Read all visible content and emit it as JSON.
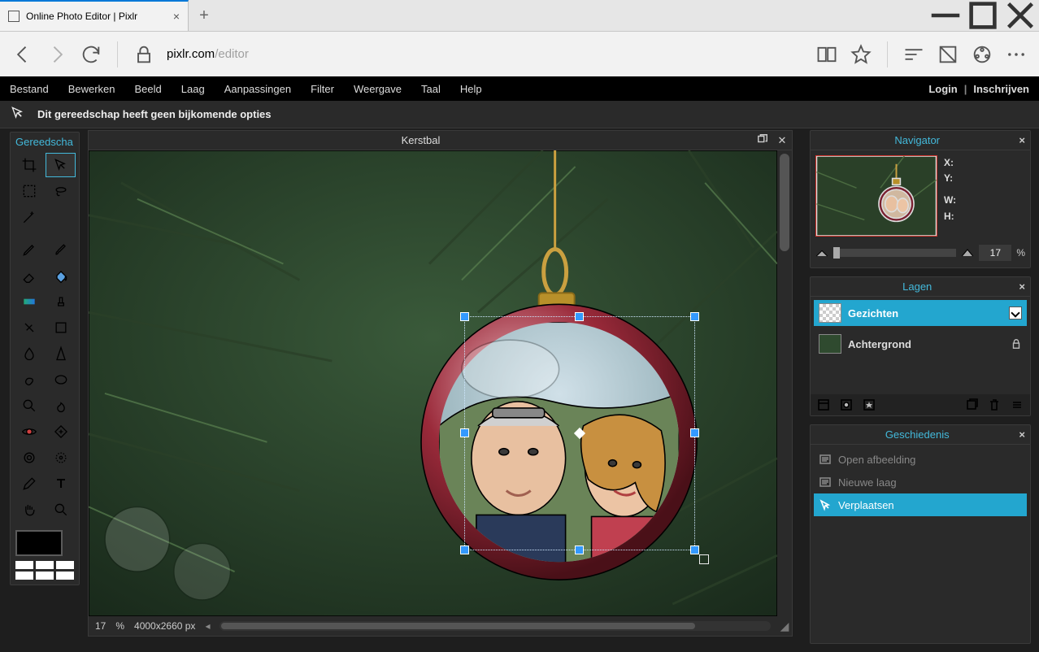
{
  "browser": {
    "tab_title": "Online Photo Editor | Pixlr",
    "url_host": "pixlr.com",
    "url_path": "/editor"
  },
  "menubar": {
    "items": [
      "Bestand",
      "Bewerken",
      "Beeld",
      "Laag",
      "Aanpassingen",
      "Filter",
      "Weergave",
      "Taal",
      "Help"
    ],
    "login": "Login",
    "signup": "Inschrijven"
  },
  "optionbar": {
    "message": "Dit gereedschap heeft geen bijkomende opties"
  },
  "toolbox": {
    "title": "Gereedscha",
    "active_tool": "move-tool"
  },
  "canvas": {
    "title": "Kerstbal",
    "zoom_percent": 17,
    "dimensions": "4000x2660 px"
  },
  "navigator": {
    "title": "Navigator",
    "x_label": "X:",
    "y_label": "Y:",
    "w_label": "W:",
    "h_label": "H:",
    "zoom_value": "17",
    "percent_symbol": "%"
  },
  "layers": {
    "title": "Lagen",
    "items": [
      {
        "name": "Gezichten",
        "active": true,
        "locked": false
      },
      {
        "name": "Achtergrond",
        "active": false,
        "locked": true
      }
    ]
  },
  "history": {
    "title": "Geschiedenis",
    "items": [
      {
        "label": "Open afbeelding",
        "active": false
      },
      {
        "label": "Nieuwe laag",
        "active": false
      },
      {
        "label": "Verplaatsen",
        "active": true
      }
    ]
  },
  "percent_symbol": "%"
}
